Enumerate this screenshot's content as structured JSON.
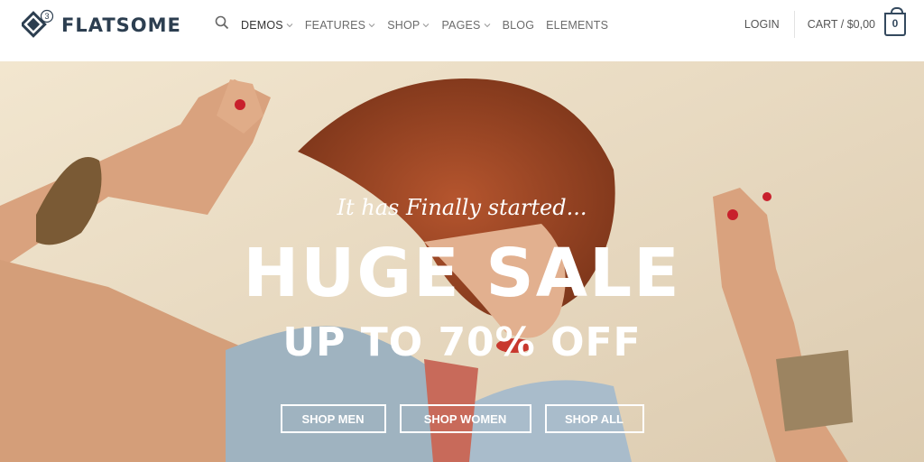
{
  "brand": {
    "name": "FLATSOME",
    "badge": "3",
    "color": "#2c3e50"
  },
  "nav": {
    "items": [
      {
        "label": "DEMOS",
        "dropdown": true,
        "active": true
      },
      {
        "label": "FEATURES",
        "dropdown": true
      },
      {
        "label": "SHOP",
        "dropdown": true
      },
      {
        "label": "PAGES",
        "dropdown": true
      },
      {
        "label": "BLOG",
        "dropdown": false
      },
      {
        "label": "ELEMENTS",
        "dropdown": false
      }
    ],
    "search_icon": "search-icon"
  },
  "account": {
    "login": "LOGIN",
    "cart": "CART / $0,00",
    "cart_count": "0"
  },
  "hero": {
    "kicker": "It has Finally started...",
    "headline": "HUGE SALE",
    "subline": "UP TO 70% OFF",
    "buttons": {
      "men": "SHOP MEN",
      "women": "SHOP WOMEN",
      "all": "SHOP ALL"
    }
  }
}
